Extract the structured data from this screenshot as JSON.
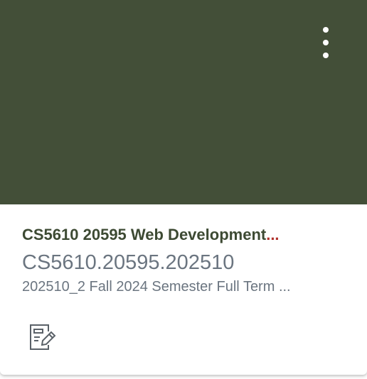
{
  "colors": {
    "hero": "#434f38",
    "title": "#3d4a33",
    "ellipsis": "#b0312c"
  },
  "course": {
    "title": "CS5610 20595 Web Development",
    "title_ellipsis": "...",
    "code": "CS5610.20595.202510",
    "term": "202510_2 Fall 2024 Semester Full Term ..."
  },
  "icons": {
    "menu": "vertical-ellipsis-icon",
    "assignments": "assignments-icon"
  }
}
